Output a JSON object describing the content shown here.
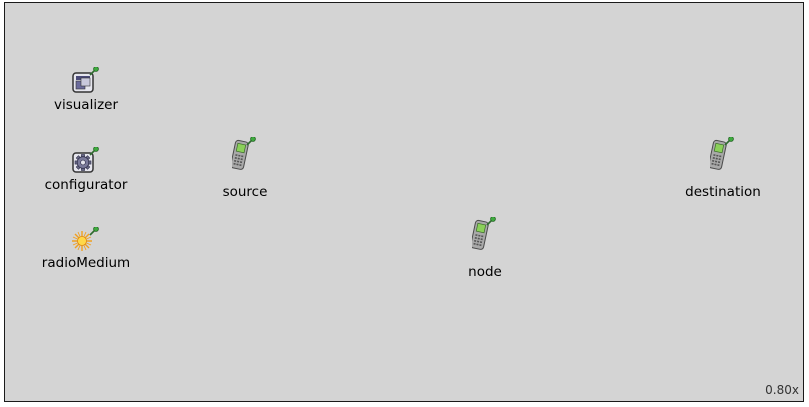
{
  "modules": {
    "visualizer": {
      "label": "visualizer",
      "icon": "visualizer-window-icon"
    },
    "configurator": {
      "label": "configurator",
      "icon": "configurator-gear-icon"
    },
    "radioMedium": {
      "label": "radioMedium",
      "icon": "radio-medium-sun-icon"
    },
    "source": {
      "label": "source",
      "icon": "mobile-phone-icon"
    },
    "node": {
      "label": "node",
      "icon": "mobile-phone-icon"
    },
    "destination": {
      "label": "destination",
      "icon": "mobile-phone-icon"
    }
  },
  "zoom": "0.80x",
  "colors": {
    "canvas_background": "#d4d4d4",
    "phone_screen": "#8bd05a",
    "pin": "#2e8b2e"
  }
}
